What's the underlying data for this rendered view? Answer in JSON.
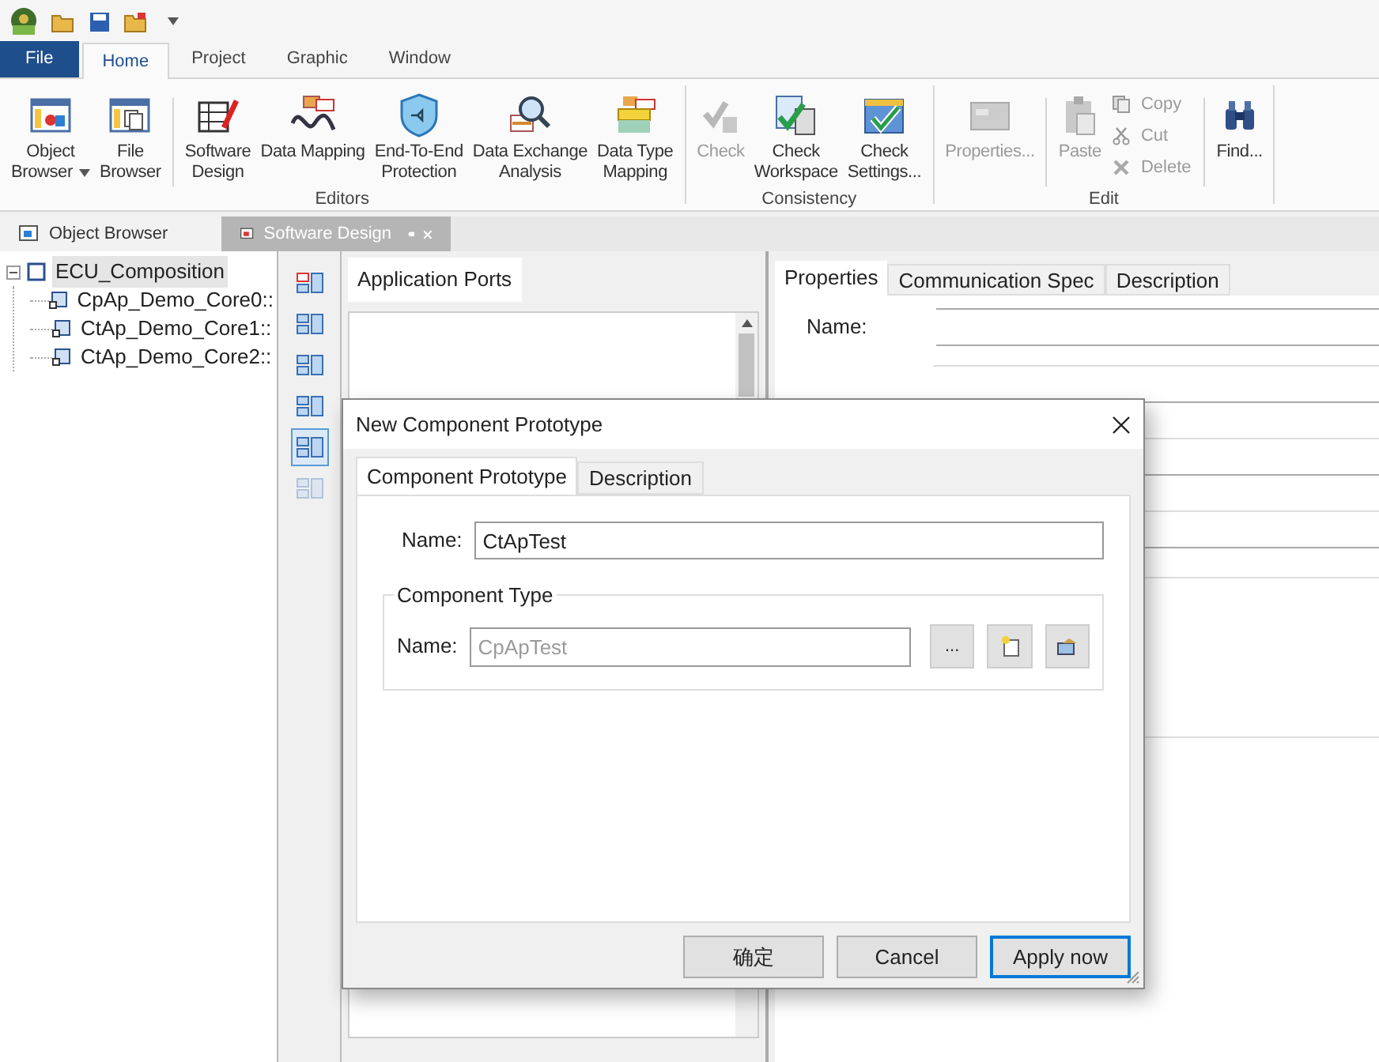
{
  "ribbon": {
    "tabs": [
      {
        "label": "File",
        "kind": "file",
        "selected": false
      },
      {
        "label": "Home",
        "kind": "tab",
        "selected": true
      },
      {
        "label": "Project",
        "kind": "tab",
        "selected": false
      },
      {
        "label": "Graphic",
        "kind": "tab",
        "selected": false
      },
      {
        "label": "Window",
        "kind": "tab",
        "selected": false
      }
    ],
    "groups": [
      {
        "label": "Editors",
        "buttons": [
          {
            "kind": "large",
            "lines": [
              "Object",
              "Browser"
            ],
            "disabled": false
          },
          {
            "kind": "large",
            "lines": [
              "File",
              "Browser"
            ],
            "disabled": false
          },
          {
            "kind": "large",
            "lines": [
              "Software",
              "Design"
            ],
            "disabled": false
          },
          {
            "kind": "large",
            "lines": [
              "Data Mapping"
            ],
            "disabled": false
          },
          {
            "kind": "large",
            "lines": [
              "End-To-End",
              "Protection"
            ],
            "disabled": false
          },
          {
            "kind": "large",
            "lines": [
              "Data Exchange",
              "Analysis"
            ],
            "disabled": false
          },
          {
            "kind": "large",
            "lines": [
              "Data Type",
              "Mapping"
            ],
            "disabled": false
          }
        ]
      },
      {
        "label": "Consistency",
        "buttons": [
          {
            "kind": "large",
            "lines": [
              "Check"
            ],
            "disabled": true
          },
          {
            "kind": "large",
            "lines": [
              "Check",
              "Workspace"
            ],
            "disabled": false
          },
          {
            "kind": "large",
            "lines": [
              "Check",
              "Settings..."
            ],
            "disabled": false
          }
        ]
      },
      {
        "label": "Edit",
        "buttons": [
          {
            "kind": "large",
            "lines": [
              "Properties..."
            ],
            "disabled": true
          },
          {
            "kind": "large",
            "lines": [
              "Paste"
            ],
            "disabled": true
          },
          {
            "kind": "small",
            "lines": [
              "Copy"
            ],
            "disabled": true
          },
          {
            "kind": "small",
            "lines": [
              "Cut"
            ],
            "disabled": true
          },
          {
            "kind": "small",
            "lines": [
              "Delete"
            ],
            "disabled": true
          },
          {
            "kind": "large",
            "lines": [
              "Find..."
            ],
            "disabled": false
          }
        ]
      }
    ]
  },
  "doc_tabs": [
    {
      "label": "Object Browser",
      "selected": false,
      "closable": false
    },
    {
      "label": "Software Design",
      "selected": true,
      "closable": true
    }
  ],
  "tree": {
    "label": "ECU_Composition",
    "expanded": true,
    "selected": true,
    "children": [
      {
        "label": "CpAp_Demo_Core0::"
      },
      {
        "label": "CtAp_Demo_Core1::"
      },
      {
        "label": "CtAp_Demo_Core2::"
      }
    ]
  },
  "side_tools": [
    {
      "selected": false,
      "disabled": false
    },
    {
      "selected": false,
      "disabled": false
    },
    {
      "selected": false,
      "disabled": false
    },
    {
      "selected": false,
      "disabled": false
    },
    {
      "selected": true,
      "disabled": false
    },
    {
      "selected": false,
      "disabled": true
    }
  ],
  "ports_panel": {
    "tab": "Application Ports"
  },
  "properties_panel": {
    "tabs": [
      {
        "label": "Properties",
        "selected": true
      },
      {
        "label": "Communication Spec",
        "selected": false
      },
      {
        "label": "Description",
        "selected": false
      }
    ],
    "name_label": "Name:"
  },
  "dialog": {
    "title": "New Component Prototype",
    "tabs": [
      {
        "label": "Component Prototype",
        "selected": true
      },
      {
        "label": "Description",
        "selected": false
      }
    ],
    "name_label": "Name:",
    "name_value": "CtApTest",
    "group_label": "Component Type",
    "type_label": "Name:",
    "type_value": "CpApTest",
    "type_disabled": true,
    "browse_button": "...",
    "buttons": [
      {
        "label": "确定",
        "default": false
      },
      {
        "label": "Cancel",
        "default": false
      },
      {
        "label": "Apply now",
        "default": true
      }
    ]
  }
}
